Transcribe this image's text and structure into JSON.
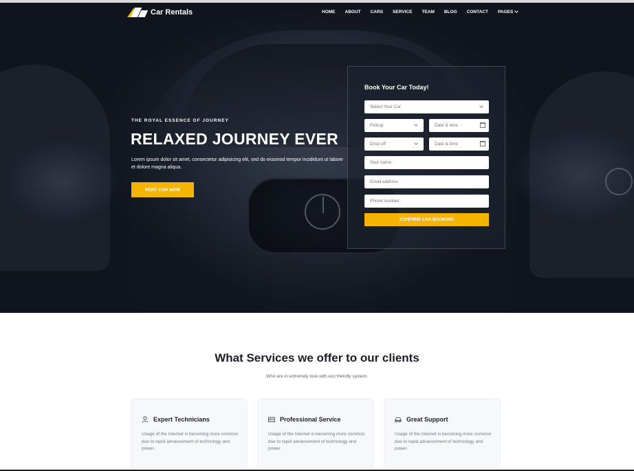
{
  "brand": {
    "name": "Car Rentals",
    "logo_icon": "logo-mark-icon",
    "accent_color": "#f5b400"
  },
  "nav": {
    "items": [
      {
        "label": "HOME"
      },
      {
        "label": "ABOUT"
      },
      {
        "label": "CARS"
      },
      {
        "label": "SERVICE"
      },
      {
        "label": "TEAM"
      },
      {
        "label": "BLOG"
      },
      {
        "label": "CONTACT"
      },
      {
        "label": "PAGES",
        "icon": "chevron-down-icon"
      }
    ]
  },
  "hero": {
    "eyebrow": "THE ROYAL ESSENCE OF JOURNEY",
    "headline": "RELAXED JOURNEY EVER",
    "lede": "Lorem ipsum dolor sit amet, consectetur adipisicing elit, sed do eiusmod tempor incididunt ut labore et dolore magna aliqua.",
    "cta": "RENT CAR NOW"
  },
  "booking": {
    "title": "Book Your Car Today!",
    "car_select": "Select Your Car",
    "pickup_select": "Pickup",
    "pickup_date": "Date & time",
    "dropoff_select": "Drop off",
    "dropoff_date": "Date & time",
    "name_placeholder": "Your name",
    "email_placeholder": "Email address",
    "phone_placeholder": "Phone number",
    "confirm": "CONFIRM CAR BOOKING"
  },
  "services": {
    "title": "What Services we offer to our clients",
    "subtitle": "Who are in extremely love with eco friendly system.",
    "cards": [
      {
        "icon": "user-icon",
        "title": "Expert Technicians",
        "text": "Usage of the Internet is becoming more common due to rapid advancement of technology and power."
      },
      {
        "icon": "id-card-icon",
        "title": "Professional Service",
        "text": "Usage of the Internet is becoming more common due to rapid advancement of technology and power."
      },
      {
        "icon": "car-icon",
        "title": "Great Support",
        "text": "Usage of the Internet is becoming more common due to rapid advancement of technology and power."
      }
    ]
  }
}
